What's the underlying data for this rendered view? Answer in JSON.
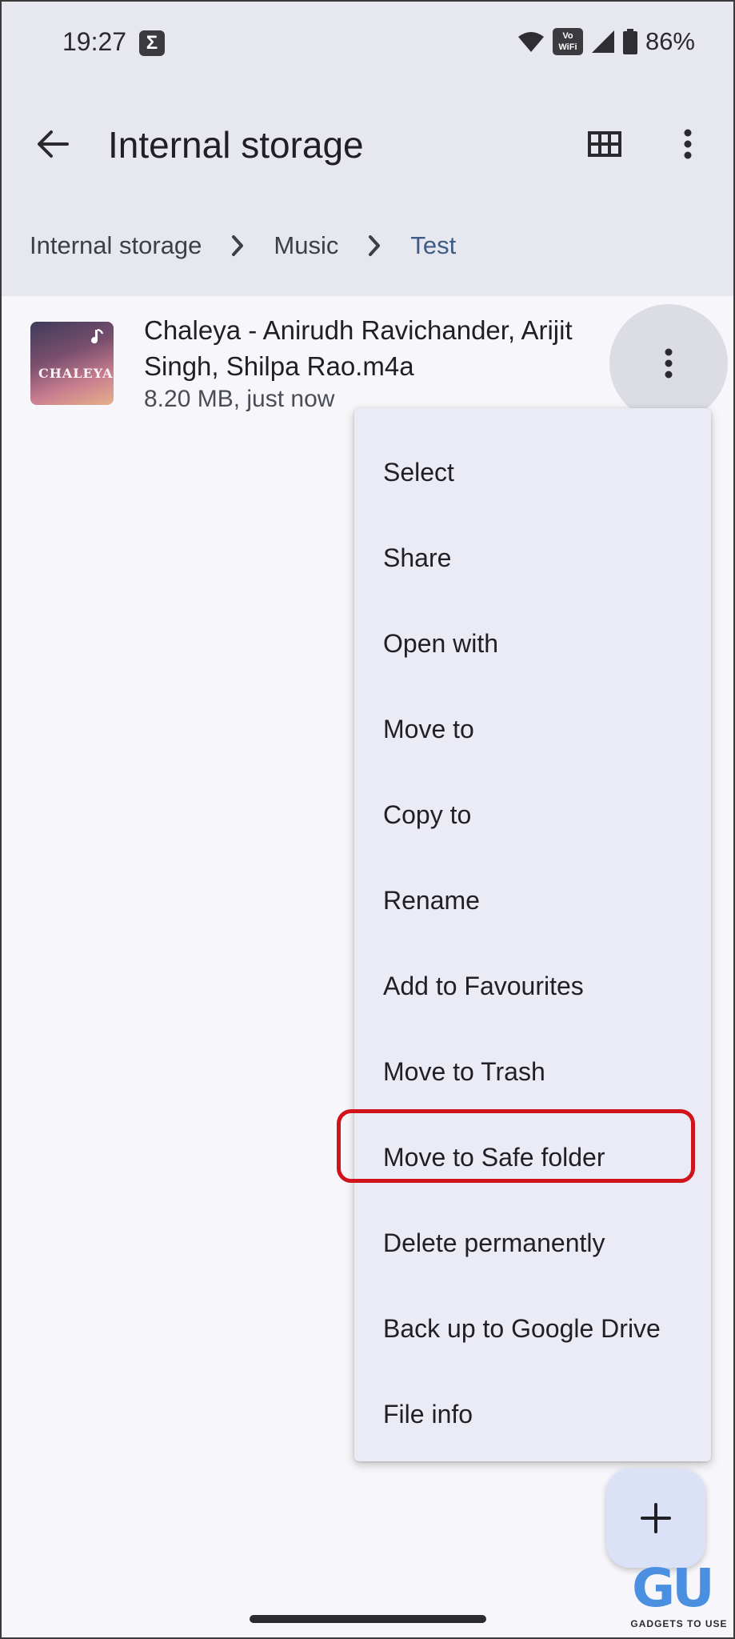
{
  "status_bar": {
    "time": "19:27",
    "sigma_glyph": "Σ",
    "vowifi_line1": "Vo",
    "vowifi_line2": "WiFi",
    "battery": "86%"
  },
  "app_bar": {
    "title": "Internal storage",
    "icons": [
      "back-arrow-icon",
      "grid-view-icon",
      "more-vert-icon"
    ]
  },
  "breadcrumb": {
    "items": [
      "Internal storage",
      "Music",
      "Test"
    ]
  },
  "file": {
    "name": "Chaleya - Anirudh Ravichander, Arijit Singh, Shilpa Rao.m4a",
    "meta": "8.20 MB, just now",
    "thumbnail_text": "CHALEYA"
  },
  "menu": {
    "items": [
      "Select",
      "Share",
      "Open with",
      "Move to",
      "Copy to",
      "Rename",
      "Add to Favourites",
      "Move to Trash",
      "Move to Safe folder",
      "Delete permanently",
      "Back up to Google Drive",
      "File info"
    ],
    "highlighted": "Move to Safe folder",
    "highlight_color": "#d0141b"
  },
  "fab": {
    "icon": "plus-icon"
  },
  "watermark": {
    "logo": "GU",
    "text": "GADGETS TO USE"
  },
  "colors": {
    "top_bg": "#e7e7ef",
    "content_bg": "#f7f7fb",
    "menu_bg": "#ebebf5",
    "breadcrumb_active": "#3e5c86",
    "fab_bg": "#dbe1f7"
  }
}
